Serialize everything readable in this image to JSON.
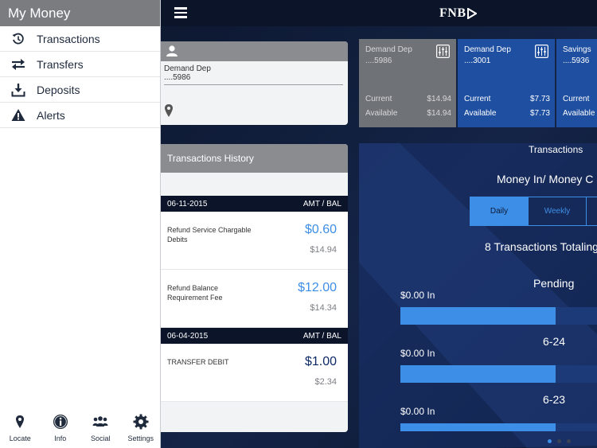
{
  "drawer": {
    "title": "My Money",
    "items": [
      {
        "label": "Transactions",
        "icon": "history-icon"
      },
      {
        "label": "Transfers",
        "icon": "transfer-arrows-icon"
      },
      {
        "label": "Deposits",
        "icon": "download-icon"
      },
      {
        "label": "Alerts",
        "icon": "warning-icon"
      }
    ],
    "bottom": [
      {
        "label": "Locate",
        "icon": "location-pin-icon"
      },
      {
        "label": "Info",
        "icon": "info-icon"
      },
      {
        "label": "Social",
        "icon": "people-icon"
      },
      {
        "label": "Settings",
        "icon": "gear-icon"
      }
    ]
  },
  "header": {
    "logo": "FNB"
  },
  "account": {
    "name": "Demand Dep",
    "number": "....5986"
  },
  "tiles": [
    {
      "name": "Demand Dep",
      "number": "....5986",
      "current_label": "Current",
      "current": "$14.94",
      "available_label": "Available",
      "available": "$14.94",
      "selected": true
    },
    {
      "name": "Demand Dep",
      "number": "....3001",
      "current_label": "Current",
      "current": "$7.73",
      "available_label": "Available",
      "available": "$7.73",
      "selected": false
    },
    {
      "name": "Savings",
      "number": "....5936",
      "current_label": "Current",
      "current": "",
      "available_label": "Available",
      "available": "",
      "selected": false
    }
  ],
  "history": {
    "title": "Transactions History",
    "groups": [
      {
        "date": "06-11-2015",
        "col_label": "AMT / BAL",
        "items": [
          {
            "desc": "Refund Service Chargable Debits",
            "amount": "$0.60",
            "balance": "$14.94"
          },
          {
            "desc": "Refund Balance Requirement Fee",
            "amount": "$12.00",
            "balance": "$14.34"
          }
        ]
      },
      {
        "date": "06-04-2015",
        "col_label": "AMT / BAL",
        "items": [
          {
            "desc": "TRANSFER DEBIT",
            "amount": "$1.00",
            "balance": "$2.34"
          }
        ]
      }
    ]
  },
  "panel": {
    "title": "Transactions",
    "subtitle": "Money In/ Money C",
    "segments": [
      "Daily",
      "Weekly"
    ],
    "active_segment": "Daily",
    "total_text": "8 Transactions Totaling",
    "groups": [
      {
        "label": "Pending",
        "in_label": "$0.00 In",
        "fill_fraction": 0.75
      },
      {
        "label": "6-24",
        "in_label": "$0.00 In",
        "fill_fraction": 0.75
      },
      {
        "label": "6-23",
        "in_label": "$0.00 In",
        "fill_fraction": 0.75
      }
    ]
  },
  "pager": {
    "count": 3,
    "active": 0
  },
  "colors": {
    "accent": "#3d8ee6",
    "navy": "#0b1429",
    "tile_blue": "#1f4fa0",
    "gray_header": "#8a8c90"
  }
}
